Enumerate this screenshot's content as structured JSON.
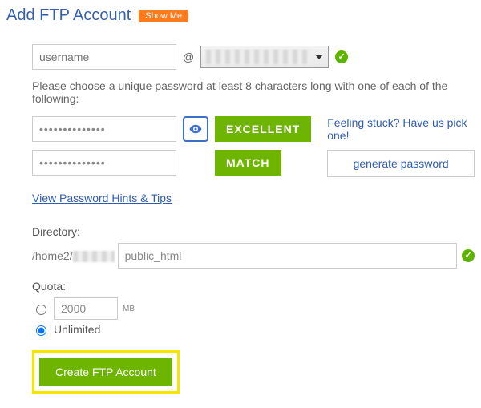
{
  "header": {
    "title": "Add FTP Account",
    "show_me": "Show Me"
  },
  "username": {
    "placeholder": "username",
    "at": "@"
  },
  "password": {
    "instruction": "Please choose a unique password at least 8 characters long with one of each of the following:",
    "value": "••••••••••••••",
    "confirm_value": "••••••••••••••",
    "strength_label": "EXCELLENT",
    "match_label": "MATCH",
    "stuck_text": "Feeling stuck? Have us pick one!",
    "generate_label": "generate password",
    "hints_link": "View Password Hints & Tips"
  },
  "directory": {
    "label": "Directory:",
    "prefix": "/home2/",
    "value": "public_html"
  },
  "quota": {
    "label": "Quota:",
    "size_value": "2000",
    "unit": "MB",
    "unlimited_label": "Unlimited",
    "selected": "unlimited"
  },
  "submit": {
    "label": "Create FTP Account"
  }
}
